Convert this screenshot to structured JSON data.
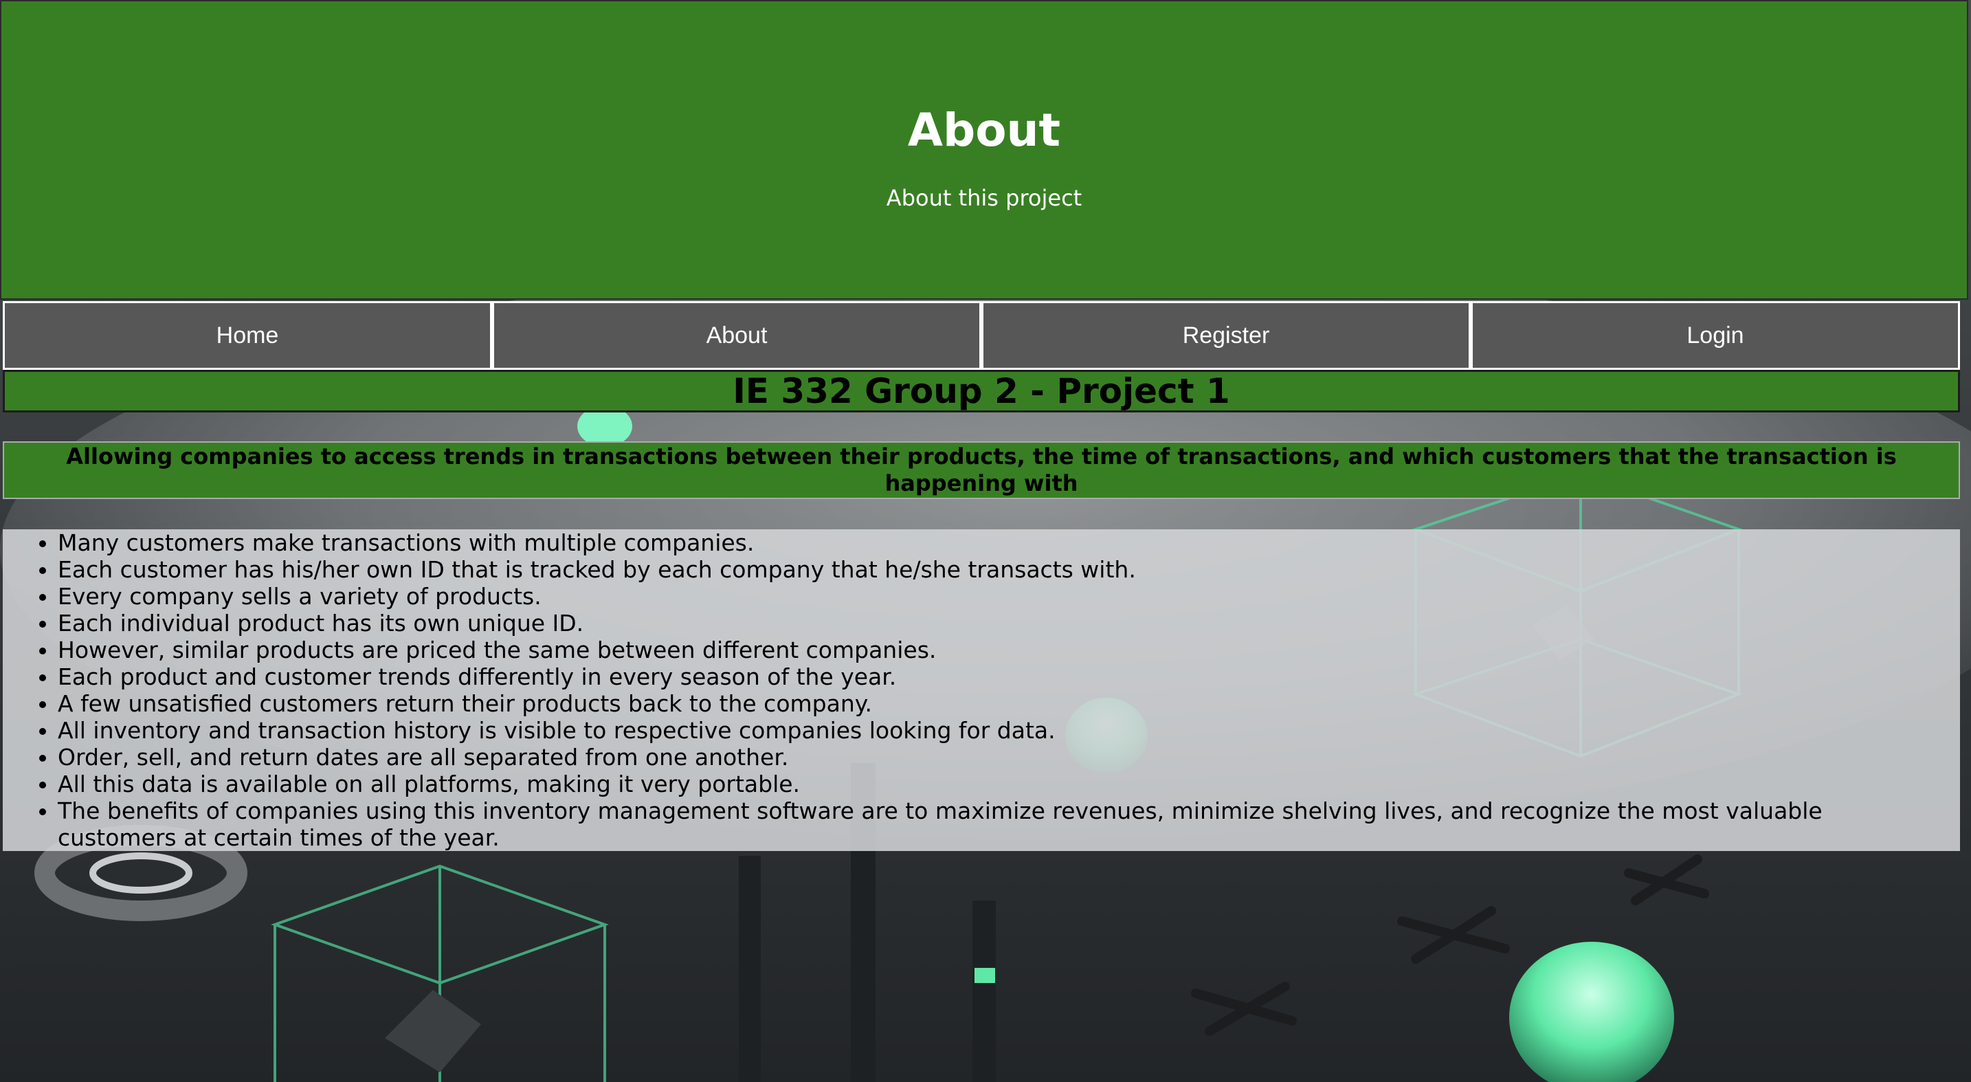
{
  "header": {
    "title": "About",
    "subtitle": "About this project"
  },
  "nav": {
    "items": [
      {
        "label": "Home"
      },
      {
        "label": "About"
      },
      {
        "label": "Register"
      },
      {
        "label": "Login"
      }
    ]
  },
  "main": {
    "project_title": "IE 332 Group 2 - Project 1",
    "tagline": "Allowing companies to access trends in transactions between their products, the time of transactions, and which customers that the transaction is happening with",
    "facts": [
      "Many customers make transactions with multiple companies.",
      "Each customer has his/her own ID that is tracked by each company that he/she transacts with.",
      "Every company sells a variety of products.",
      "Each individual product has its own unique ID.",
      "However, similar products are priced the same between different companies.",
      "Each product and customer trends differently in every season of the year.",
      "A few unsatisfied customers return their products back to the company.",
      "All inventory and transaction history is visible to respective companies looking for data.",
      "Order, sell, and return dates are all separated from one another.",
      "All this data is available on all platforms, making it very portable.",
      "The benefits of companies using this inventory management software are to maximize revenues, minimize shelving lives, and recognize the most valuable customers at certain times of the year."
    ]
  },
  "colors": {
    "header_green": "#387f23",
    "nav_gray": "#575757",
    "accent_mint": "#5ee8a6"
  }
}
